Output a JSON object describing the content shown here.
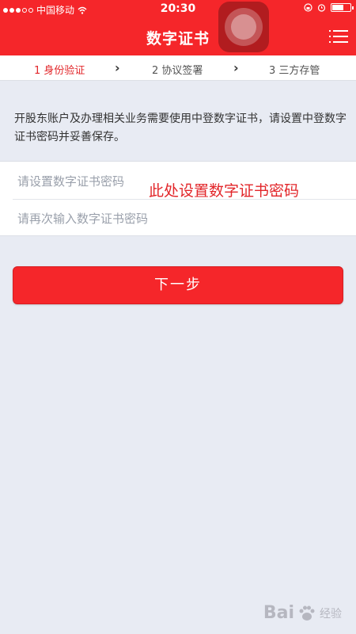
{
  "status_bar": {
    "carrier": "中国移动",
    "time": "20:30"
  },
  "nav": {
    "title": "数字证书"
  },
  "steps": [
    {
      "label": "1 身份验证",
      "active": true
    },
    {
      "label": "2 协议签署",
      "active": false
    },
    {
      "label": "3 三方存管",
      "active": false
    }
  ],
  "info": {
    "text": "开股东账户及办理相关业务需要使用中登数字证书，请设置中登数字证书密码并妥善保存。"
  },
  "form": {
    "password_placeholder": "请设置数字证书密码",
    "confirm_placeholder": "请再次输入数字证书密码"
  },
  "annotation": {
    "text": "此处设置数字证书密码"
  },
  "next_button": {
    "label": "下一步"
  },
  "watermark": {
    "brand": "Bai",
    "suffix": "经验"
  },
  "colors": {
    "brand_red": "#f5262a",
    "active_step": "#e2262a",
    "background": "#e8ebf3"
  }
}
